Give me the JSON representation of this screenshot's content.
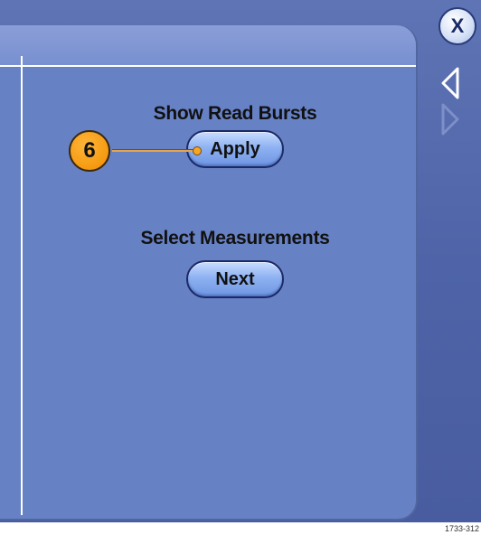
{
  "dialog": {
    "sections": [
      {
        "label": "Show Read Bursts",
        "button_label": "Apply"
      },
      {
        "label": "Select Measurements",
        "button_label": "Next"
      }
    ]
  },
  "callout": {
    "number": "6",
    "color": "#f59a10"
  },
  "controls": {
    "close_label": "X",
    "prev_icon": "triangle-left-icon",
    "next_icon": "triangle-right-icon"
  },
  "figure_id": "1733-312",
  "colors": {
    "panel": "#6781c5",
    "background": "#4f64a8",
    "button_fill": "#8eb2f2",
    "accent": "#f59a10"
  }
}
